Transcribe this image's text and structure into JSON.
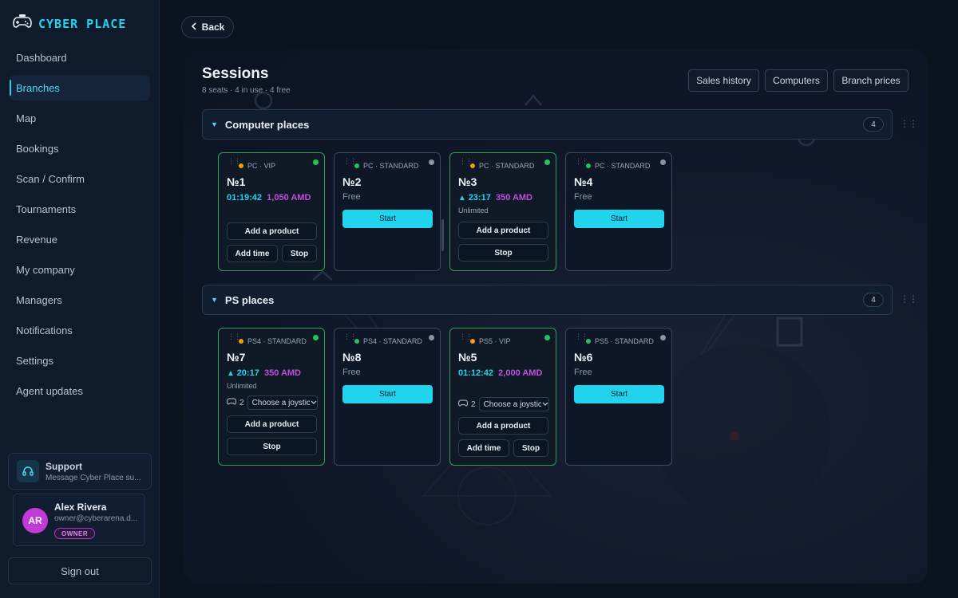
{
  "brand": {
    "name": "CYBER PLACE",
    "accent": "#22d3ee"
  },
  "sidebar": {
    "items": [
      {
        "label": "Dashboard"
      },
      {
        "label": "Branches",
        "active": true
      },
      {
        "label": "Map"
      },
      {
        "label": "Bookings"
      },
      {
        "label": "Scan / Confirm"
      },
      {
        "label": "Tournaments"
      },
      {
        "label": "Revenue"
      },
      {
        "label": "My company"
      },
      {
        "label": "Managers"
      },
      {
        "label": "Notifications"
      },
      {
        "label": "Settings"
      },
      {
        "label": "Agent updates"
      }
    ],
    "support": {
      "title": "Support",
      "subtitle": "Message Cyber Place su..."
    },
    "user": {
      "initials": "AR",
      "name": "Alex Rivera",
      "email": "owner@cyberarena.d...",
      "role": "OWNER"
    },
    "signout_label": "Sign out"
  },
  "header": {
    "back_label": "Back",
    "title": "Sessions",
    "subtitle": "8 seats · 4 in use · 4 free",
    "buttons": [
      "Sales history",
      "Computers",
      "Branch prices"
    ]
  },
  "groups": [
    {
      "title": "Computer places",
      "count": "4",
      "cards": [
        {
          "type": "PC · VIP",
          "tier": "vip",
          "number": "№1",
          "busy": true,
          "timer": "01:19:42",
          "amount": "1,050 AMD",
          "actions": {
            "add_product": "Add a product",
            "add_time": "Add time",
            "stop": "Stop"
          }
        },
        {
          "type": "PC · STANDARD",
          "tier": "standard",
          "number": "№2",
          "busy": false,
          "free_label": "Free",
          "start_label": "Start"
        },
        {
          "type": "PC · STANDARD",
          "tier": "vip",
          "number": "№3",
          "busy": true,
          "timer": "23:17",
          "amount": "350 AMD",
          "tariff": "Unlimited",
          "actions": {
            "add_product": "Add a product",
            "stop": "Stop"
          }
        },
        {
          "type": "PC · STANDARD",
          "tier": "standard",
          "number": "№4",
          "busy": false,
          "free_label": "Free",
          "start_label": "Start"
        }
      ]
    },
    {
      "title": "PS places",
      "count": "4",
      "cards": [
        {
          "type": "PS4 · STANDARD",
          "tier": "vip",
          "number": "№7",
          "busy": true,
          "timer": "20:17",
          "amount": "350 AMD",
          "tariff": "Unlimited",
          "joysticks": "2",
          "joystick_placeholder": "Choose a joystick",
          "actions": {
            "add_product": "Add a product",
            "stop": "Stop"
          }
        },
        {
          "type": "PS4 · STANDARD",
          "tier": "standard",
          "number": "№8",
          "busy": false,
          "free_label": "Free",
          "start_label": "Start"
        },
        {
          "type": "PS5 · VIP",
          "tier": "vip",
          "number": "№5",
          "busy": true,
          "timer": "01:12:42",
          "amount": "2,000 AMD",
          "joysticks": "2",
          "joystick_placeholder": "Choose a joystick",
          "actions": {
            "add_product": "Add a product",
            "add_time": "Add time",
            "stop": "Stop"
          }
        },
        {
          "type": "PS5 · STANDARD",
          "tier": "standard",
          "number": "№6",
          "busy": false,
          "free_label": "Free",
          "start_label": "Start"
        }
      ]
    }
  ],
  "colors": {
    "busy_border": "#2f9e55",
    "status_busy": "#22c55e",
    "status_free": "#8a94a3",
    "vip_dot": "#f59e0b",
    "standard_dot": "#22c55e",
    "amount": "#c04fe0",
    "timer": "#22d3ee"
  }
}
